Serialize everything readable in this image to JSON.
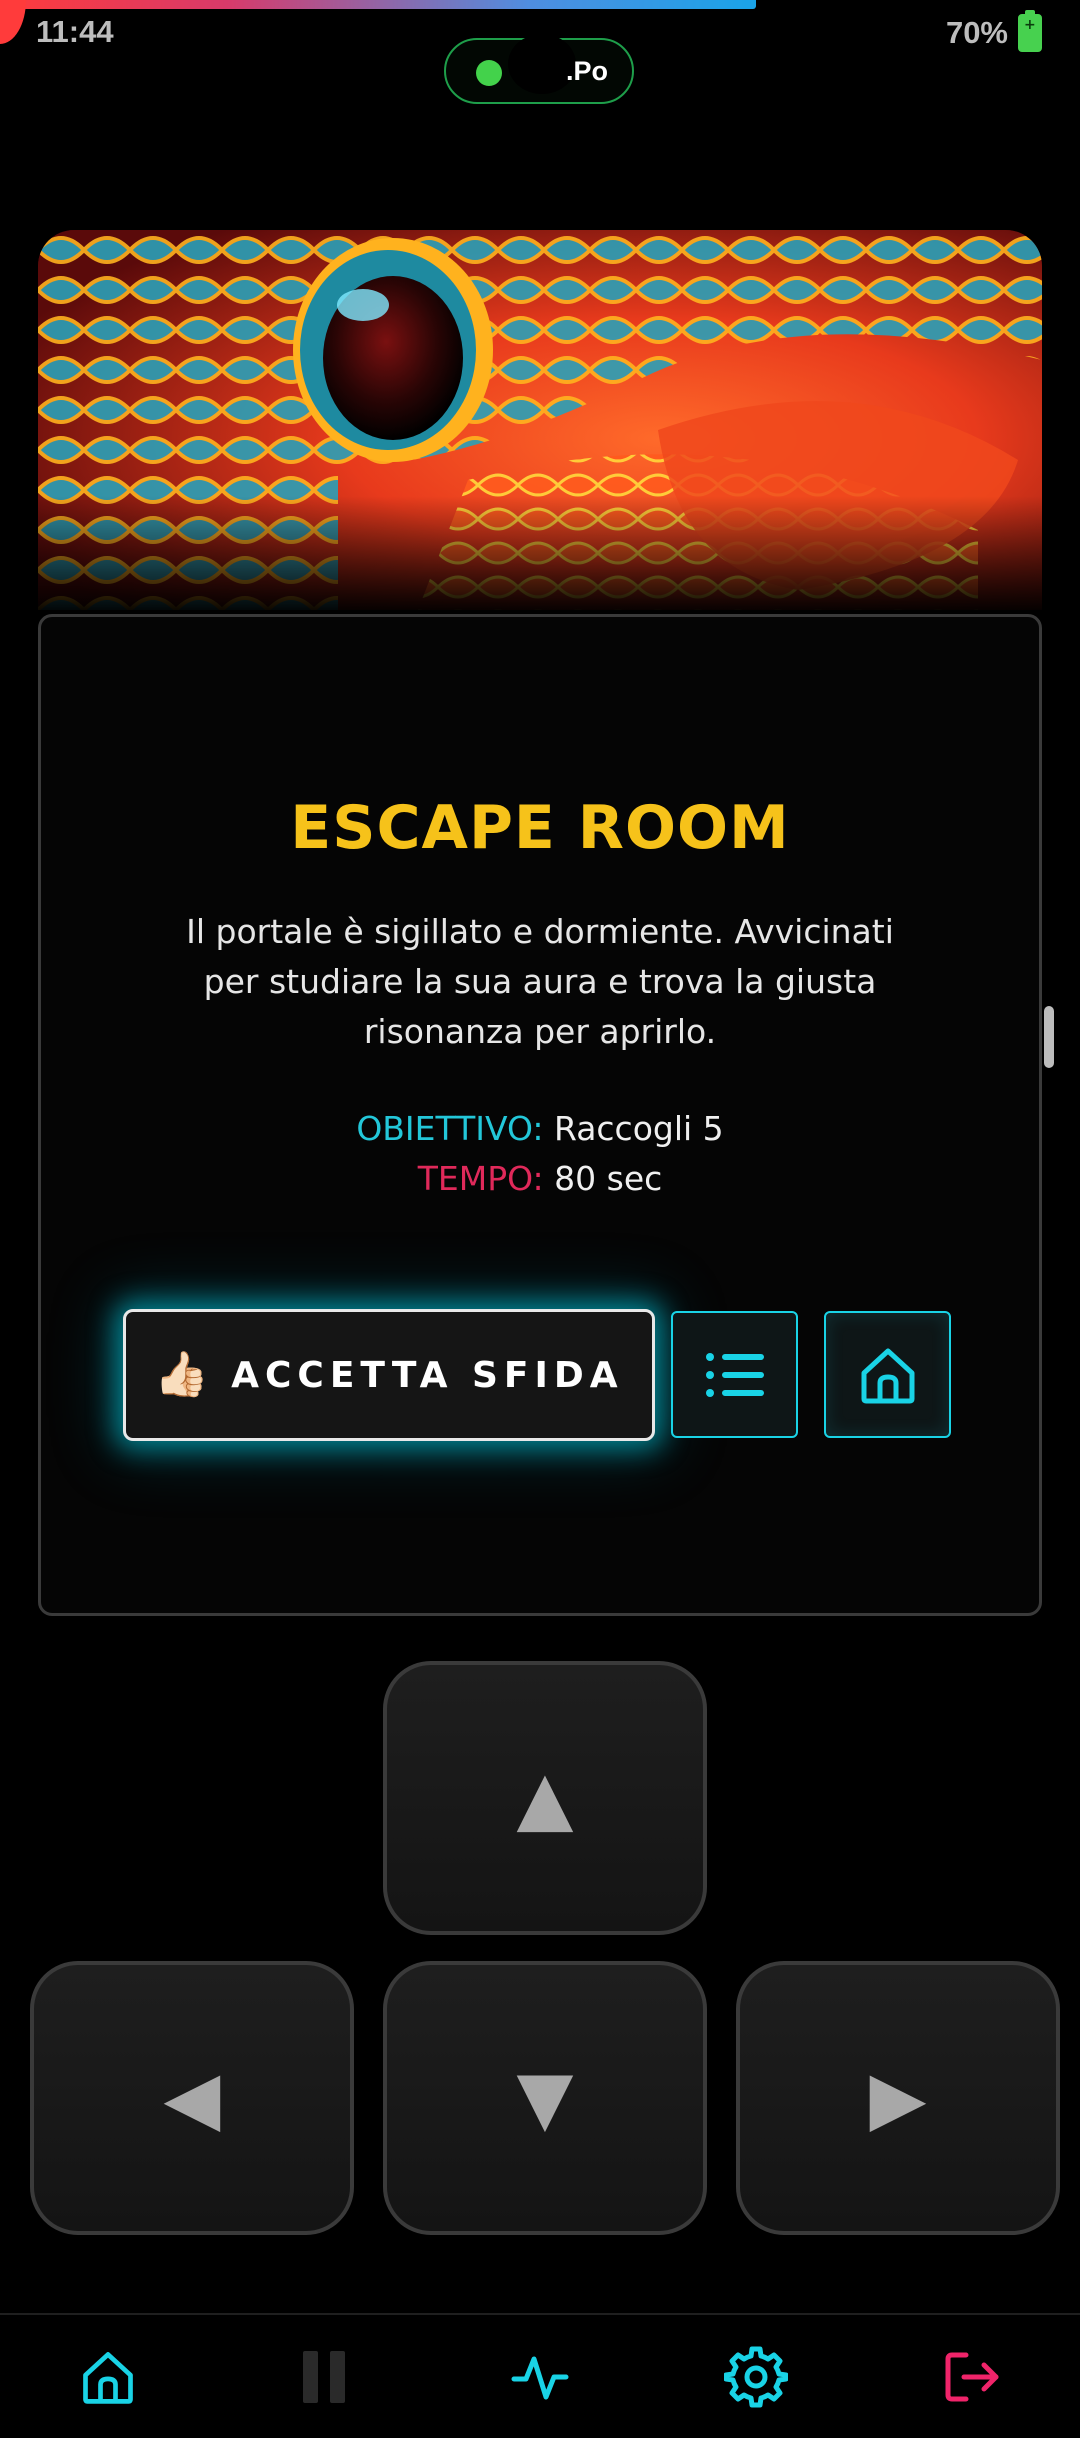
{
  "status_bar": {
    "time": "11:44",
    "battery_percent": "70%",
    "pill_text": ".Po"
  },
  "hero": {
    "image": "snake-eye-illustration"
  },
  "challenge": {
    "title": "ESCAPE ROOM",
    "description": "Il portale è sigillato e dormiente. Avvicinati per studiare la sua aura e trova la giusta risonanza per aprirlo.",
    "objective_label": "OBIETTIVO:",
    "objective_value": "Raccogli 5",
    "time_label": "TEMPO:",
    "time_value": "80 sec",
    "accept_icon": "👍🏻",
    "accept_label": "ACCETTA SFIDA"
  },
  "dpad": {
    "up": "▲",
    "left": "◀",
    "down": "▼",
    "right": "▶"
  },
  "bottom_nav": {
    "items": [
      "home-icon",
      "pause-icon",
      "activity-icon",
      "settings-icon",
      "logout-icon"
    ]
  },
  "colors": {
    "accent_cyan": "#19d3e6",
    "title_yellow": "#f6c21a",
    "danger_red": "#e0295a",
    "status_green": "#43d24b"
  }
}
